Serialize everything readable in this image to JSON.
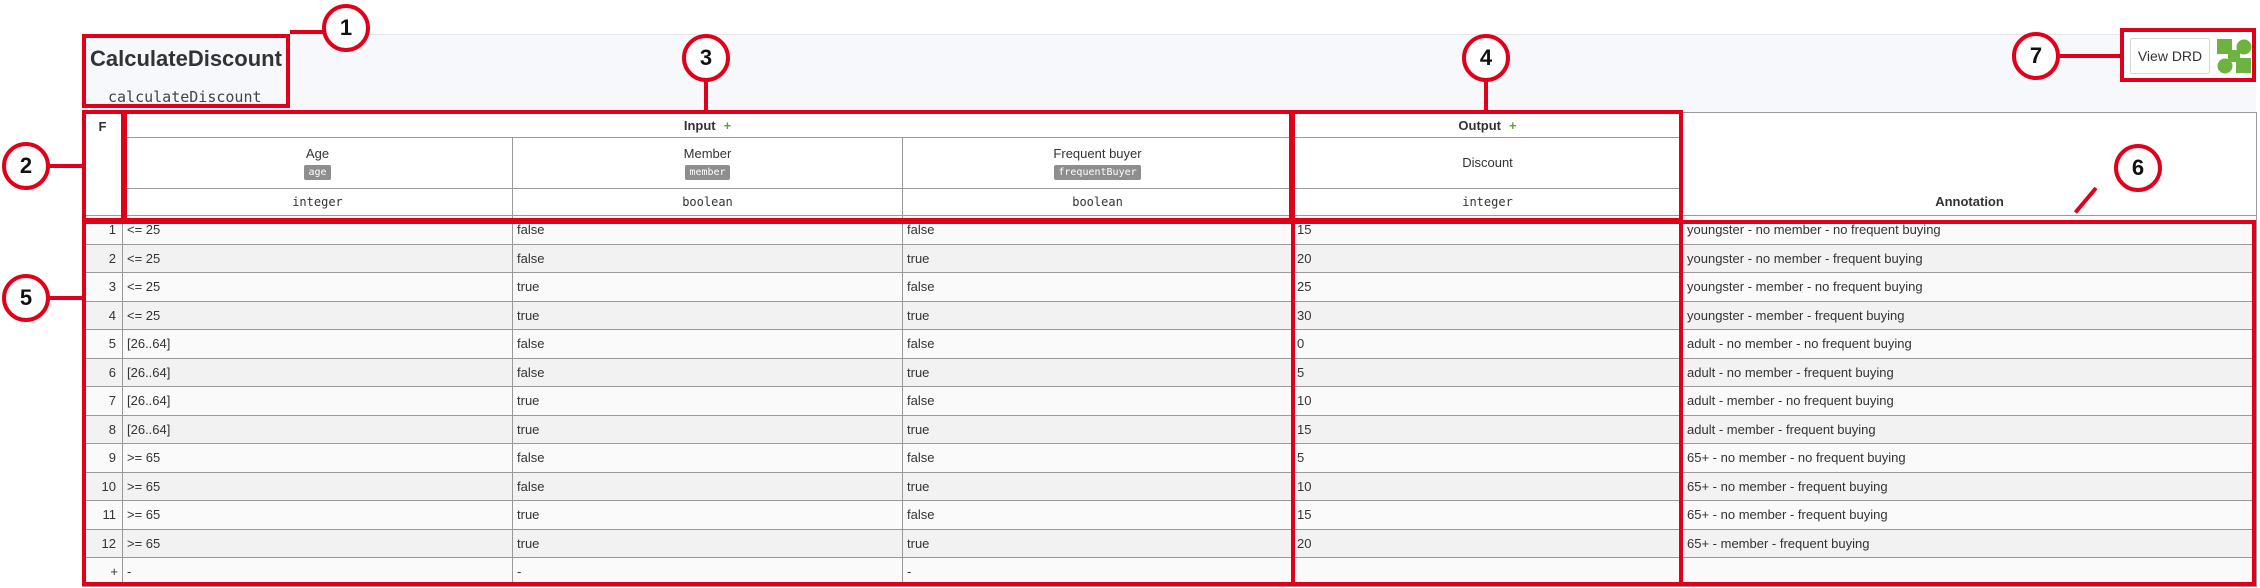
{
  "decision": {
    "name": "CalculateDiscount",
    "id": "calculateDiscount"
  },
  "drd": {
    "label": "View DRD",
    "icon": "drd-diagram-icon"
  },
  "table": {
    "hit_policy": "F",
    "input_label": "Input",
    "output_label": "Output",
    "add_symbol": "+",
    "inputs": [
      {
        "label": "Age",
        "variable": "age",
        "type": "integer"
      },
      {
        "label": "Member",
        "variable": "member",
        "type": "boolean"
      },
      {
        "label": "Frequent buyer",
        "variable": "frequentBuyer",
        "type": "boolean"
      }
    ],
    "outputs": [
      {
        "label": "Discount",
        "type": "integer"
      }
    ],
    "annotation_label": "Annotation",
    "rules": [
      {
        "n": "1",
        "age": "<= 25",
        "member": "false",
        "frequent": "false",
        "discount": "15",
        "annotation": "youngster - no member - no frequent buying"
      },
      {
        "n": "2",
        "age": "<= 25",
        "member": "false",
        "frequent": "true",
        "discount": "20",
        "annotation": "youngster - no member - frequent buying"
      },
      {
        "n": "3",
        "age": "<= 25",
        "member": "true",
        "frequent": "false",
        "discount": "25",
        "annotation": "youngster - member - no frequent buying"
      },
      {
        "n": "4",
        "age": "<= 25",
        "member": "true",
        "frequent": "true",
        "discount": "30",
        "annotation": "youngster - member - frequent buying"
      },
      {
        "n": "5",
        "age": "[26..64]",
        "member": "false",
        "frequent": "false",
        "discount": "0",
        "annotation": "adult - no member - no frequent buying"
      },
      {
        "n": "6",
        "age": "[26..64]",
        "member": "false",
        "frequent": "true",
        "discount": "5",
        "annotation": "adult - no member - frequent buying"
      },
      {
        "n": "7",
        "age": "[26..64]",
        "member": "true",
        "frequent": "false",
        "discount": "10",
        "annotation": "adult - member - no frequent buying"
      },
      {
        "n": "8",
        "age": "[26..64]",
        "member": "true",
        "frequent": "true",
        "discount": "15",
        "annotation": "adult - member - frequent buying"
      },
      {
        "n": "9",
        "age": ">= 65",
        "member": "false",
        "frequent": "false",
        "discount": "5",
        "annotation": "65+ - no member - no frequent buying"
      },
      {
        "n": "10",
        "age": ">= 65",
        "member": "false",
        "frequent": "true",
        "discount": "10",
        "annotation": "65+ - no member - frequent buying"
      },
      {
        "n": "11",
        "age": ">= 65",
        "member": "true",
        "frequent": "false",
        "discount": "15",
        "annotation": "65+ - no member - frequent buying"
      },
      {
        "n": "12",
        "age": ">= 65",
        "member": "true",
        "frequent": "true",
        "discount": "20",
        "annotation": "65+ - member - frequent buying"
      }
    ],
    "new_rule": {
      "add": "+",
      "placeholder": "-"
    }
  },
  "markers": [
    "1",
    "2",
    "3",
    "4",
    "5",
    "6",
    "7"
  ],
  "colors": {
    "highlight": "#e0001a",
    "add_green": "#5aa632",
    "badge": "#8e8e8e"
  }
}
